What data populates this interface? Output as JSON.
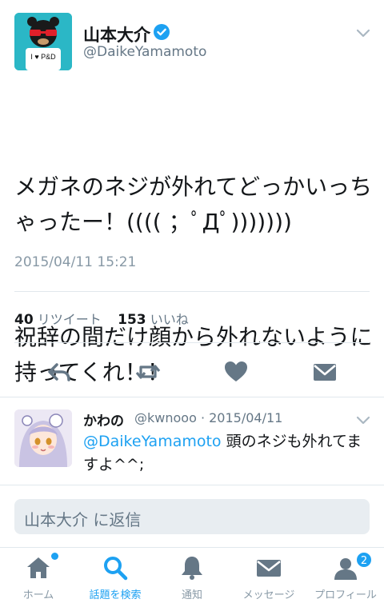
{
  "tweet": {
    "author_name": "山本大介",
    "author_handle": "@DaikeYamamoto",
    "avatar_text": "I ♥ P&D",
    "text_para1": "メガネのネジが外れてどっかいっちゃったー！(((( ；ﾟДﾟ)))))))",
    "text_para2": "祝辞の間だけ顔から外れないように持ってくれ！！",
    "timestamp": "2015/04/11 15:21",
    "retweet_count": "40",
    "retweet_label": "リツイート",
    "like_count": "153",
    "like_label": "いいね"
  },
  "reply": {
    "name": "かわの",
    "handle_date": "@kwnooo · 2015/04/11",
    "mention": "@DaikeYamamoto",
    "text": " 頭のネジも外れてますよ^^;"
  },
  "compose": {
    "placeholder": "山本大介 に返信"
  },
  "tabs": [
    {
      "label": "ホーム",
      "icon": "home-icon"
    },
    {
      "label": "話題を検索",
      "icon": "search-icon"
    },
    {
      "label": "通知",
      "icon": "bell-icon"
    },
    {
      "label": "メッセージ",
      "icon": "envelope-icon"
    },
    {
      "label": "プロフィール",
      "icon": "profile-icon",
      "badge": "2"
    }
  ],
  "colors": {
    "accent": "#1da1f2",
    "muted": "#657786",
    "icon": "#657786"
  }
}
